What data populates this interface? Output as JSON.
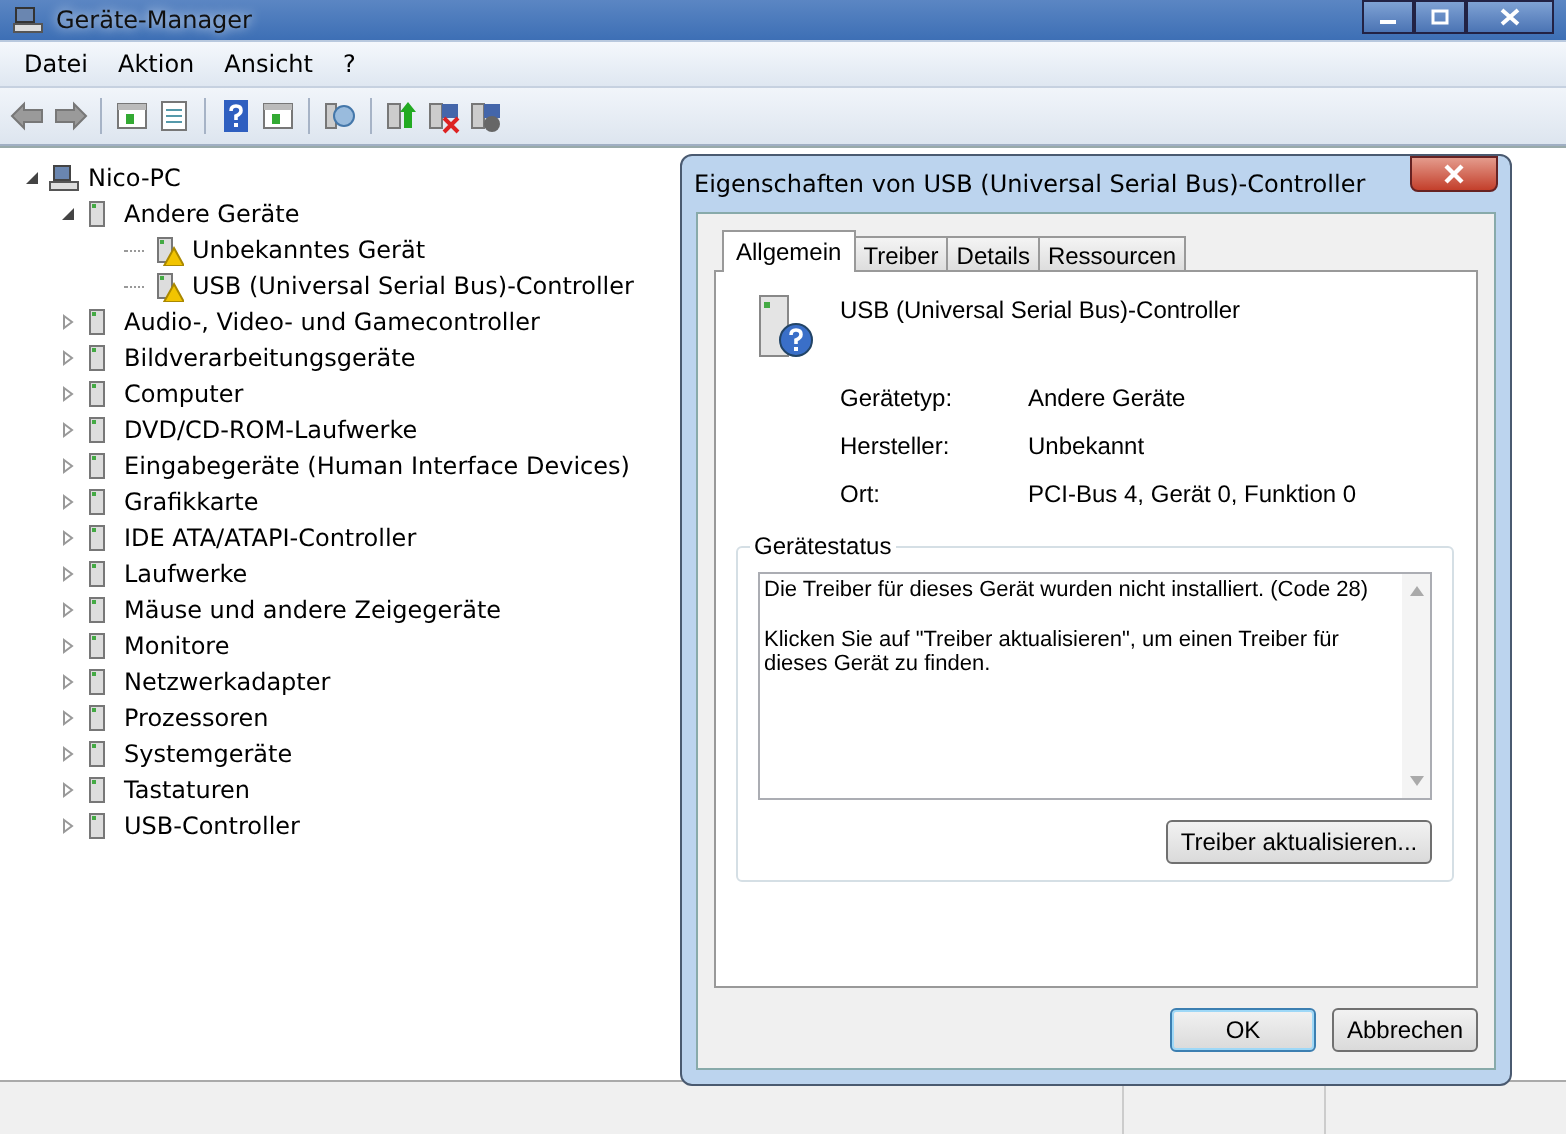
{
  "window": {
    "title": "Geräte-Manager"
  },
  "menu": [
    "Datei",
    "Aktion",
    "Ansicht",
    "?"
  ],
  "tree": {
    "label": "Nico-PC",
    "expanded": true,
    "children": [
      {
        "label": "Andere Geräte",
        "expanded": true,
        "warning": false,
        "children": [
          {
            "label": "Unbekanntes Gerät",
            "warning": true
          },
          {
            "label": "USB (Universal Serial Bus)-Controller",
            "warning": true
          }
        ]
      },
      {
        "label": "Audio-, Video- und Gamecontroller",
        "expanded": false,
        "warning": false
      },
      {
        "label": "Bildverarbeitungsgeräte",
        "expanded": false,
        "warning": false
      },
      {
        "label": "Computer",
        "expanded": false,
        "warning": false
      },
      {
        "label": "DVD/CD-ROM-Laufwerke",
        "expanded": false,
        "warning": false
      },
      {
        "label": "Eingabegeräte (Human Interface Devices)",
        "expanded": false,
        "warning": false
      },
      {
        "label": "Grafikkarte",
        "expanded": false,
        "warning": false
      },
      {
        "label": "IDE ATA/ATAPI-Controller",
        "expanded": false,
        "warning": false
      },
      {
        "label": "Laufwerke",
        "expanded": false,
        "warning": false
      },
      {
        "label": "Mäuse und andere Zeigegeräte",
        "expanded": false,
        "warning": false
      },
      {
        "label": "Monitore",
        "expanded": false,
        "warning": false
      },
      {
        "label": "Netzwerkadapter",
        "expanded": false,
        "warning": false
      },
      {
        "label": "Prozessoren",
        "expanded": false,
        "warning": false
      },
      {
        "label": "Systemgeräte",
        "expanded": false,
        "warning": false
      },
      {
        "label": "Tastaturen",
        "expanded": false,
        "warning": false
      },
      {
        "label": "USB-Controller",
        "expanded": false,
        "warning": false
      }
    ]
  },
  "dialog": {
    "title": "Eigenschaften von USB (Universal Serial Bus)-Controller",
    "tabs": [
      {
        "label": "Allgemein",
        "selected": true
      },
      {
        "label": "Treiber",
        "selected": false
      },
      {
        "label": "Details",
        "selected": false
      },
      {
        "label": "Ressourcen",
        "selected": false
      }
    ],
    "device_name": "USB (Universal Serial Bus)-Controller",
    "properties": [
      {
        "label": "Gerätetyp:",
        "value": "Andere Geräte"
      },
      {
        "label": "Hersteller:",
        "value": "Unbekannt"
      },
      {
        "label": "Ort:",
        "value": "PCI-Bus 4, Gerät 0, Funktion 0"
      }
    ],
    "status_group": "Gerätestatus",
    "status_text": [
      "Die Treiber für dieses Gerät wurden nicht installiert. (Code 28)",
      "Klicken Sie auf \"Treiber aktualisieren\", um einen Treiber für dieses Gerät zu finden."
    ],
    "update_button": "Treiber aktualisieren...",
    "buttons": [
      "OK",
      "Abbrechen"
    ]
  }
}
